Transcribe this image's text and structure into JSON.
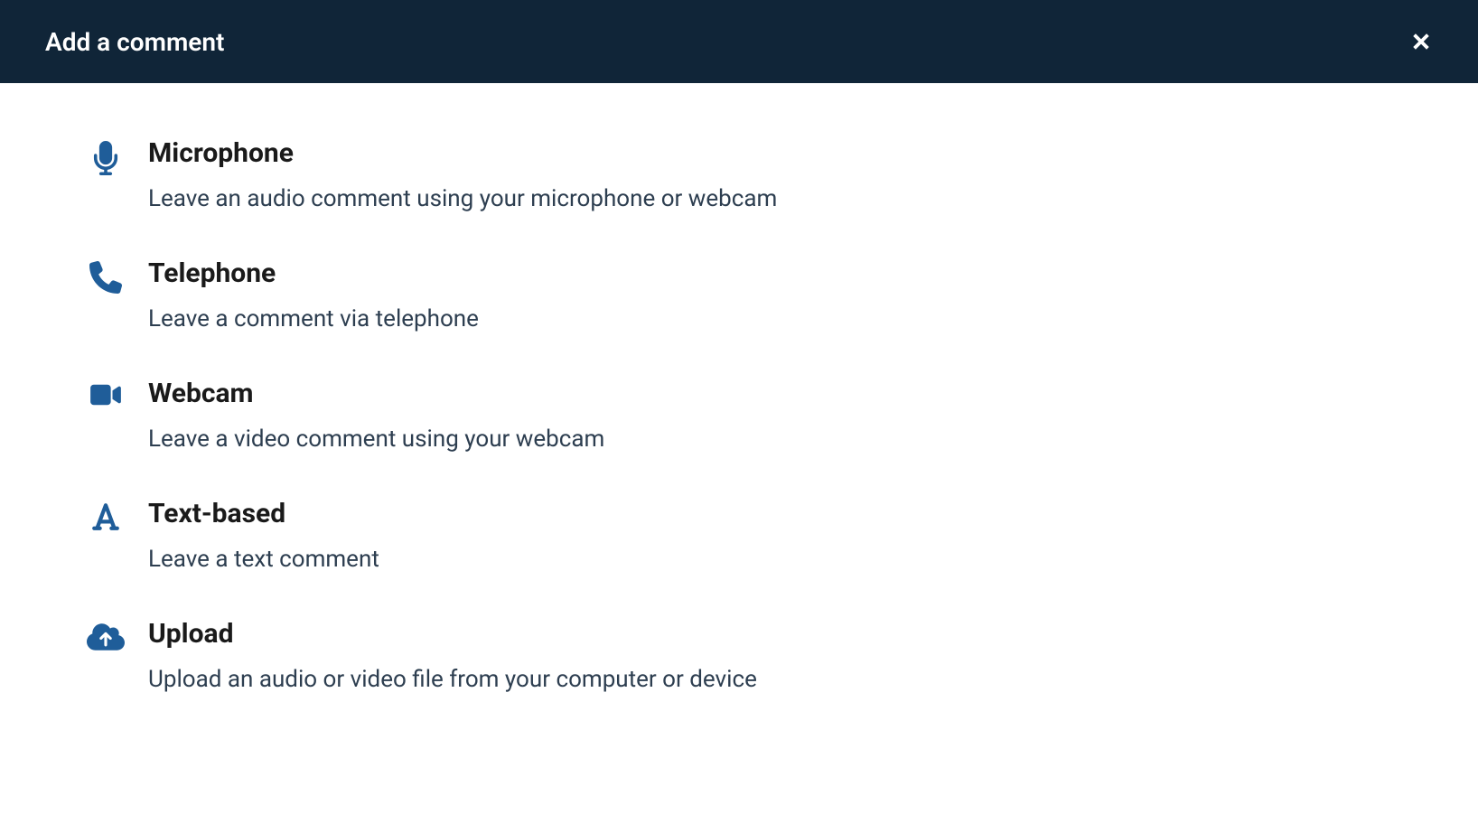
{
  "header": {
    "title": "Add a comment"
  },
  "options": [
    {
      "title": "Microphone",
      "description": "Leave an audio comment using your microphone or webcam"
    },
    {
      "title": "Telephone",
      "description": "Leave a comment via telephone"
    },
    {
      "title": "Webcam",
      "description": "Leave a video comment using your webcam"
    },
    {
      "title": "Text-based",
      "description": "Leave a text comment"
    },
    {
      "title": "Upload",
      "description": "Upload an audio or video file from your computer or device"
    }
  ]
}
